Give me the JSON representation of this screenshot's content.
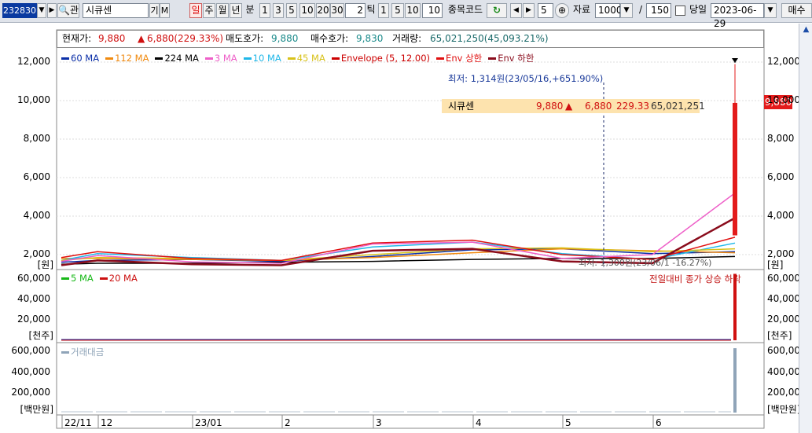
{
  "toolbar": {
    "stock_code": "232830",
    "button_gwan": "관",
    "stock_name": "시큐센",
    "btn_gi": "기",
    "btn_m": "M",
    "period_tabs": [
      "일",
      "주",
      "월",
      "년"
    ],
    "label_bun": "분",
    "minute_buttons": [
      "1",
      "3",
      "5",
      "10",
      "20",
      "30"
    ],
    "tick_value": "2",
    "label_tick": "틱",
    "tick_buttons": [
      "1",
      "5",
      "10"
    ],
    "tick_value2": "10",
    "label_stock_code": "종목코드",
    "step_value": "5",
    "label_data": "자료",
    "data_count": "1000",
    "slash": "/",
    "total_count": "150",
    "label_today": "당일",
    "date_value": "2023-06-29",
    "label_trade": "매수"
  },
  "info": {
    "current_label": "현재가:",
    "current_value": "9,880",
    "change_value": "6,880(229.33%)",
    "ask_label": "매도호가:",
    "ask_value": "9,880",
    "bid_label": "매수호가:",
    "bid_value": "9,830",
    "volume_label": "거래량:",
    "volume_value": "65,021,250(45,093.21%)"
  },
  "legend_price": [
    {
      "label": "60 MA",
      "color": "#0b2fa8"
    },
    {
      "label": "112 MA",
      "color": "#f08a10"
    },
    {
      "label": "224 MA",
      "color": "#000000"
    },
    {
      "label": "3 MA",
      "color": "#ee5fc8"
    },
    {
      "label": "10 MA",
      "color": "#1fb7e8"
    },
    {
      "label": "45 MA",
      "color": "#d8c21a"
    },
    {
      "label": "Envelope (5, 12.00)",
      "color": "#cc0000"
    },
    {
      "label": "Env 상한",
      "color": "#e01010"
    },
    {
      "label": "Env 하한",
      "color": "#8a0c1c"
    }
  ],
  "legend_volume": [
    {
      "label": "5 MA",
      "color": "#18b818"
    },
    {
      "label": "20 MA",
      "color": "#cc1010"
    }
  ],
  "legend_amount": [
    {
      "label": "거래대금",
      "color": "#8fa4b8"
    }
  ],
  "annotations": {
    "high_low": "최저: 1,314원(23/05/16,+651.90%)",
    "low_mark": "최저: 1,300원(23/06/1 -16.27%)",
    "volume_note": "전일대비 종가 상승 하락"
  },
  "callout": {
    "name": "시큐센",
    "price": "9,880",
    "arrow": "▲",
    "change": "6,880",
    "pct": "229.33",
    "volume": "65,021,251"
  },
  "price_tag": "9,880",
  "price_axis": {
    "ticks": [
      "12,000",
      "10,000",
      "8,000",
      "6,000",
      "4,000",
      "2,000"
    ],
    "unit": "[원]"
  },
  "volume_axis": {
    "ticks": [
      "60,000",
      "40,000",
      "20,000"
    ],
    "unit": "[천주]"
  },
  "amount_axis": {
    "ticks": [
      "600,000",
      "400,000",
      "200,000"
    ],
    "unit": "[백만원]"
  },
  "x_labels": [
    "22/11",
    "12",
    "23/01",
    "2",
    "3",
    "4",
    "5",
    "6"
  ],
  "colors": {
    "up": "#e31b1b",
    "down": "#1b3ae3",
    "panel_border": "#888888"
  },
  "chart_data": [
    {
      "type": "line",
      "title": "",
      "ylabel": "[원]",
      "ylim": [
        1000,
        13000
      ],
      "x": [
        "22/11",
        "12",
        "23/01",
        "2",
        "3",
        "4",
        "5",
        "6",
        "23/06/29"
      ],
      "series": [
        {
          "name": "3 MA",
          "values": [
            1650,
            1950,
            1620,
            1550,
            2550,
            2650,
            1800,
            2000,
            5200
          ]
        },
        {
          "name": "Env 하한",
          "values": [
            1450,
            1700,
            1500,
            1450,
            2200,
            2300,
            1650,
            1550,
            3900
          ]
        }
      ],
      "last_candle": {
        "open": 3000,
        "close": 9880,
        "high": 11900,
        "low": 7600
      }
    },
    {
      "type": "bar",
      "title": "",
      "ylabel": "[천주]",
      "ylim": [
        0,
        70000
      ],
      "categories": [
        "23/06/29"
      ],
      "values": [
        65021
      ]
    },
    {
      "type": "bar",
      "title": "",
      "ylabel": "[백만원]",
      "ylim": [
        0,
        650000
      ],
      "categories": [
        "23/06/29"
      ],
      "values": [
        630000
      ]
    }
  ]
}
